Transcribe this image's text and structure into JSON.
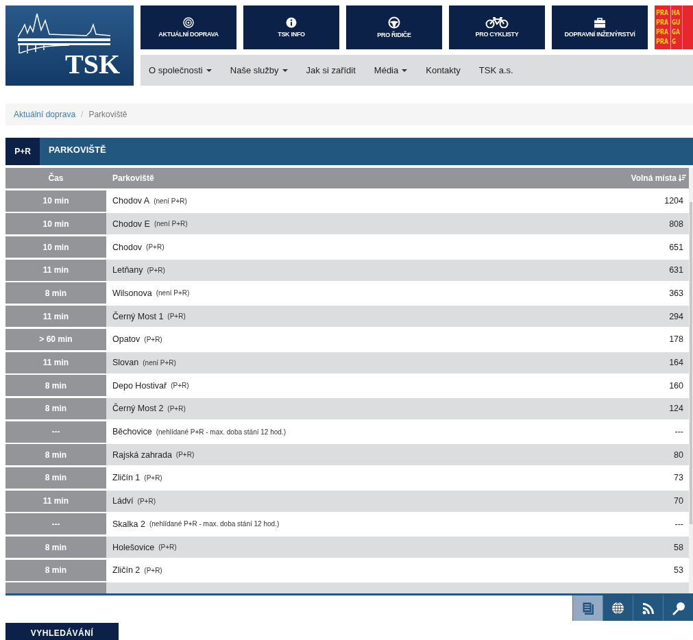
{
  "logo": {
    "text": "TSK"
  },
  "sections": [
    {
      "label": "AKTUÁLNÍ DOPRAVA"
    },
    {
      "label": "TSK INFO"
    },
    {
      "label": "PRO ŘIDIČE"
    },
    {
      "label": "PRO CYKLISTY"
    },
    {
      "label": "DOPRAVNÍ INŽENÝRSTVÍ"
    }
  ],
  "praha_logo": {
    "columns": [
      [
        "PRA",
        "PRA",
        "PRA",
        "PRA"
      ],
      [
        "HA",
        "GU",
        "GA",
        "G"
      ]
    ]
  },
  "nav": [
    {
      "label": "O společnosti",
      "dropdown": true
    },
    {
      "label": "Naše služby",
      "dropdown": true
    },
    {
      "label": "Jak si zařídit",
      "dropdown": false
    },
    {
      "label": "Média",
      "dropdown": true
    },
    {
      "label": "Kontakty",
      "dropdown": false
    },
    {
      "label": "TSK a.s.",
      "dropdown": false
    }
  ],
  "breadcrumb": {
    "link": "Aktuální doprava",
    "separator": "/",
    "current": "Parkoviště"
  },
  "panel": {
    "badge": "P+R",
    "title": "PARKOVIŠTĚ"
  },
  "table": {
    "columns": [
      "Čas",
      "Parkoviště",
      "Volná místa"
    ],
    "rows": [
      {
        "time": "10 min",
        "name": "Chodov A",
        "note": "(není P+R)",
        "free": "1204"
      },
      {
        "time": "10 min",
        "name": "Chodov E",
        "note": "(není P+R)",
        "free": "808"
      },
      {
        "time": "10 min",
        "name": "Chodov",
        "note": "(P+R)",
        "free": "651"
      },
      {
        "time": "11 min",
        "name": "Letňany",
        "note": "(P+R)",
        "free": "631"
      },
      {
        "time": "8 min",
        "name": "Wilsonova",
        "note": "(není P+R)",
        "free": "363"
      },
      {
        "time": "11 min",
        "name": "Černý Most 1",
        "note": "(P+R)",
        "free": "294"
      },
      {
        "time": "> 60 min",
        "name": "Opatov",
        "note": "(P+R)",
        "free": "178"
      },
      {
        "time": "11 min",
        "name": "Slovan",
        "note": "(není P+R)",
        "free": "164"
      },
      {
        "time": "8 min",
        "name": "Depo Hostivař",
        "note": "(P+R)",
        "free": "160"
      },
      {
        "time": "8 min",
        "name": "Černý Most 2",
        "note": "(P+R)",
        "free": "124"
      },
      {
        "time": "---",
        "name": "Běchovice",
        "note": "(nehlídané P+R - max. doba stání 12 hod.)",
        "free": "---"
      },
      {
        "time": "8 min",
        "name": "Rajská zahrada",
        "note": "(P+R)",
        "free": "80"
      },
      {
        "time": "8 min",
        "name": "Zličín 1",
        "note": "(P+R)",
        "free": "73"
      },
      {
        "time": "11 min",
        "name": "Ládví",
        "note": "(P+R)",
        "free": "70"
      },
      {
        "time": "---",
        "name": "Skalka 2",
        "note": "(nehlídané P+R - max. doba stání 12 hod.)",
        "free": "---"
      },
      {
        "time": "8 min",
        "name": "Holešovice",
        "note": "(P+R)",
        "free": "58"
      },
      {
        "time": "8 min",
        "name": "Zličín 2",
        "note": "(P+R)",
        "free": "53"
      }
    ]
  },
  "view_buttons": [
    {
      "selected": true
    },
    {
      "selected": false
    },
    {
      "selected": false
    },
    {
      "selected": false
    }
  ],
  "search_button": {
    "label": "VYHLEDÁVÁNÍ"
  }
}
